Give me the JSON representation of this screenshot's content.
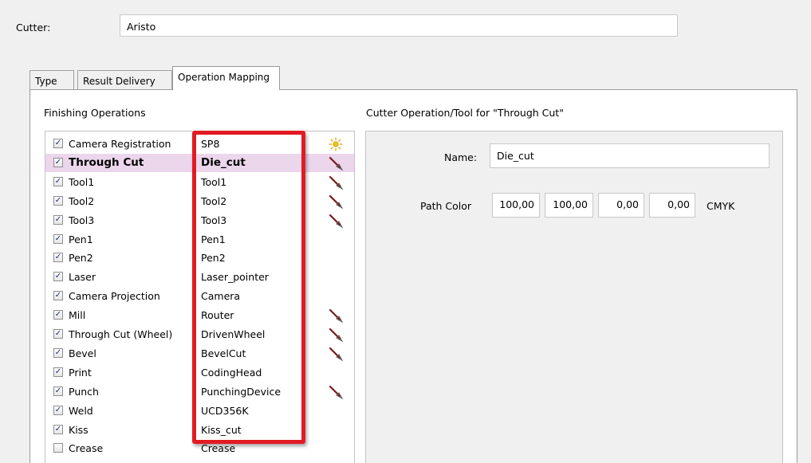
{
  "cutter": {
    "label": "Cutter:",
    "value": "Aristo"
  },
  "tabs": [
    {
      "label": "Type"
    },
    {
      "label": "Result Delivery"
    },
    {
      "label": "Operation Mapping"
    }
  ],
  "finishing": {
    "title": "Finishing Operations",
    "rows": [
      {
        "op": "Camera Registration",
        "tool": "SP8",
        "checked": "✓",
        "icon": "sun-icon"
      },
      {
        "op": "Through Cut",
        "tool": "Die_cut",
        "checked": "✓",
        "icon": "knife-tool-icon"
      },
      {
        "op": "Tool1",
        "tool": "Tool1",
        "checked": "✓",
        "icon": "knife-tool-icon"
      },
      {
        "op": "Tool2",
        "tool": "Tool2",
        "checked": "✓",
        "icon": "knife-tool-icon"
      },
      {
        "op": "Tool3",
        "tool": "Tool3",
        "checked": "✓",
        "icon": "knife-tool-icon"
      },
      {
        "op": "Pen1",
        "tool": "Pen1",
        "checked": "✓",
        "icon": ""
      },
      {
        "op": "Pen2",
        "tool": "Pen2",
        "checked": "✓",
        "icon": ""
      },
      {
        "op": "Laser",
        "tool": "Laser_pointer",
        "checked": "✓",
        "icon": ""
      },
      {
        "op": "Camera Projection",
        "tool": "Camera",
        "checked": "✓",
        "icon": ""
      },
      {
        "op": "Mill",
        "tool": "Router",
        "checked": "✓",
        "icon": "knife-tool-icon"
      },
      {
        "op": "Through Cut (Wheel)",
        "tool": "DrivenWheel",
        "checked": "✓",
        "icon": "knife-tool-icon"
      },
      {
        "op": "Bevel",
        "tool": "BevelCut",
        "checked": "✓",
        "icon": "knife-tool-icon"
      },
      {
        "op": "Print",
        "tool": "CodingHead",
        "checked": "✓",
        "icon": ""
      },
      {
        "op": "Punch",
        "tool": "PunchingDevice",
        "checked": "✓",
        "icon": "knife-tool-icon"
      },
      {
        "op": "Weld",
        "tool": "UCD356K",
        "checked": "✓",
        "icon": ""
      },
      {
        "op": "Kiss",
        "tool": "Kiss_cut",
        "checked": "✓",
        "icon": ""
      },
      {
        "op": "Crease",
        "tool": "Crease",
        "checked": "",
        "icon": ""
      }
    ]
  },
  "detail": {
    "title": "Cutter Operation/Tool for \"Through Cut\"",
    "name_label": "Name:",
    "name_value": "Die_cut",
    "path_color_label": "Path Color",
    "cmyk": [
      "100,00",
      "100,00",
      "0,00",
      "0,00"
    ],
    "cmyk_label": "CMYK"
  },
  "colors": {
    "selected_row": "#ecd6ec",
    "highlight_box": "#e21b23"
  }
}
